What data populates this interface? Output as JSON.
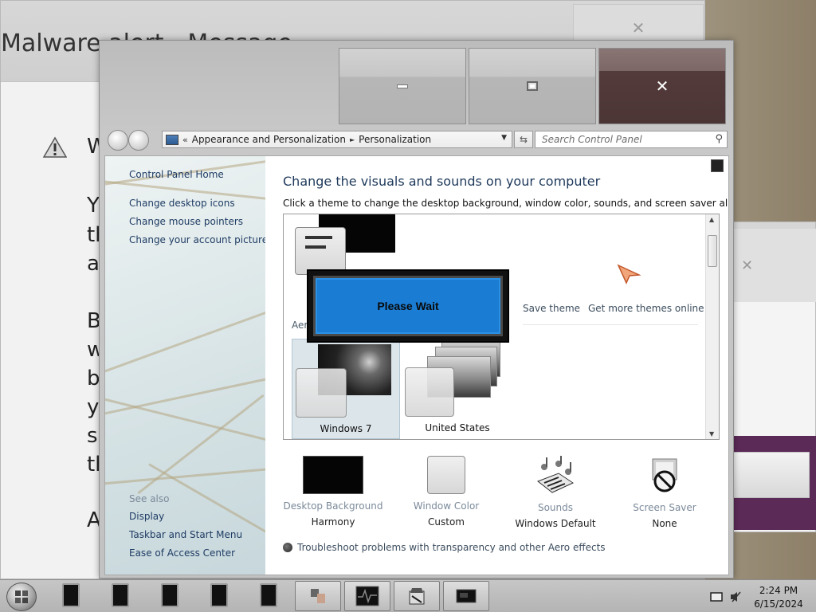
{
  "background_window": {
    "title": "Malware alert - Message",
    "letters": [
      "W",
      "Y",
      "th",
      "a",
      "B",
      "w",
      "b",
      "y",
      "s",
      "th",
      "A"
    ],
    "close_glyph": "✕"
  },
  "right_window": {
    "close_glyph": "✕"
  },
  "window": {
    "minimize_glyph": "",
    "maximize_glyph": "",
    "close_glyph": "✕"
  },
  "navigation": {
    "breadcrumb_prefix": "«",
    "breadcrumb": [
      "Appearance and Personalization",
      "Personalization"
    ],
    "separator": "►",
    "dropdown_glyph": "▼",
    "refresh_glyph": "⇆",
    "search_placeholder": "Search Control Panel",
    "search_glyph": "⚲"
  },
  "left_pane": {
    "home": "Control Panel Home",
    "links": [
      "Change desktop icons",
      "Change mouse pointers",
      "Change your account picture"
    ],
    "see_also_title": "See also",
    "see_also": [
      "Display",
      "Taskbar and Start Menu",
      "Ease of Access Center"
    ]
  },
  "main": {
    "heading": "Change the visuals and sounds on your computer",
    "description": "Click a theme to change the desktop background, window color, sounds, and screen saver all at once.",
    "save_theme": "Save theme",
    "more_themes": "Get more themes online",
    "aero_label": "Aero Themes (7)",
    "themes": [
      "Windows 7",
      "United States"
    ],
    "troubleshoot": "Troubleshoot problems with transparency and other Aero effects"
  },
  "modal": {
    "text": "Please Wait"
  },
  "settings": [
    {
      "label": "Desktop Background",
      "value": "Harmony"
    },
    {
      "label": "Window Color",
      "value": "Custom"
    },
    {
      "label": "Sounds",
      "value": "Windows Default"
    },
    {
      "label": "Screen Saver",
      "value": "None"
    }
  ],
  "taskbar": {
    "time": "2:24 PM",
    "date": "6/15/2024"
  },
  "colors": {
    "modal_blue": "#1a7cd3",
    "close_button": "#543b3b",
    "link_blue": "#1e3c64"
  }
}
